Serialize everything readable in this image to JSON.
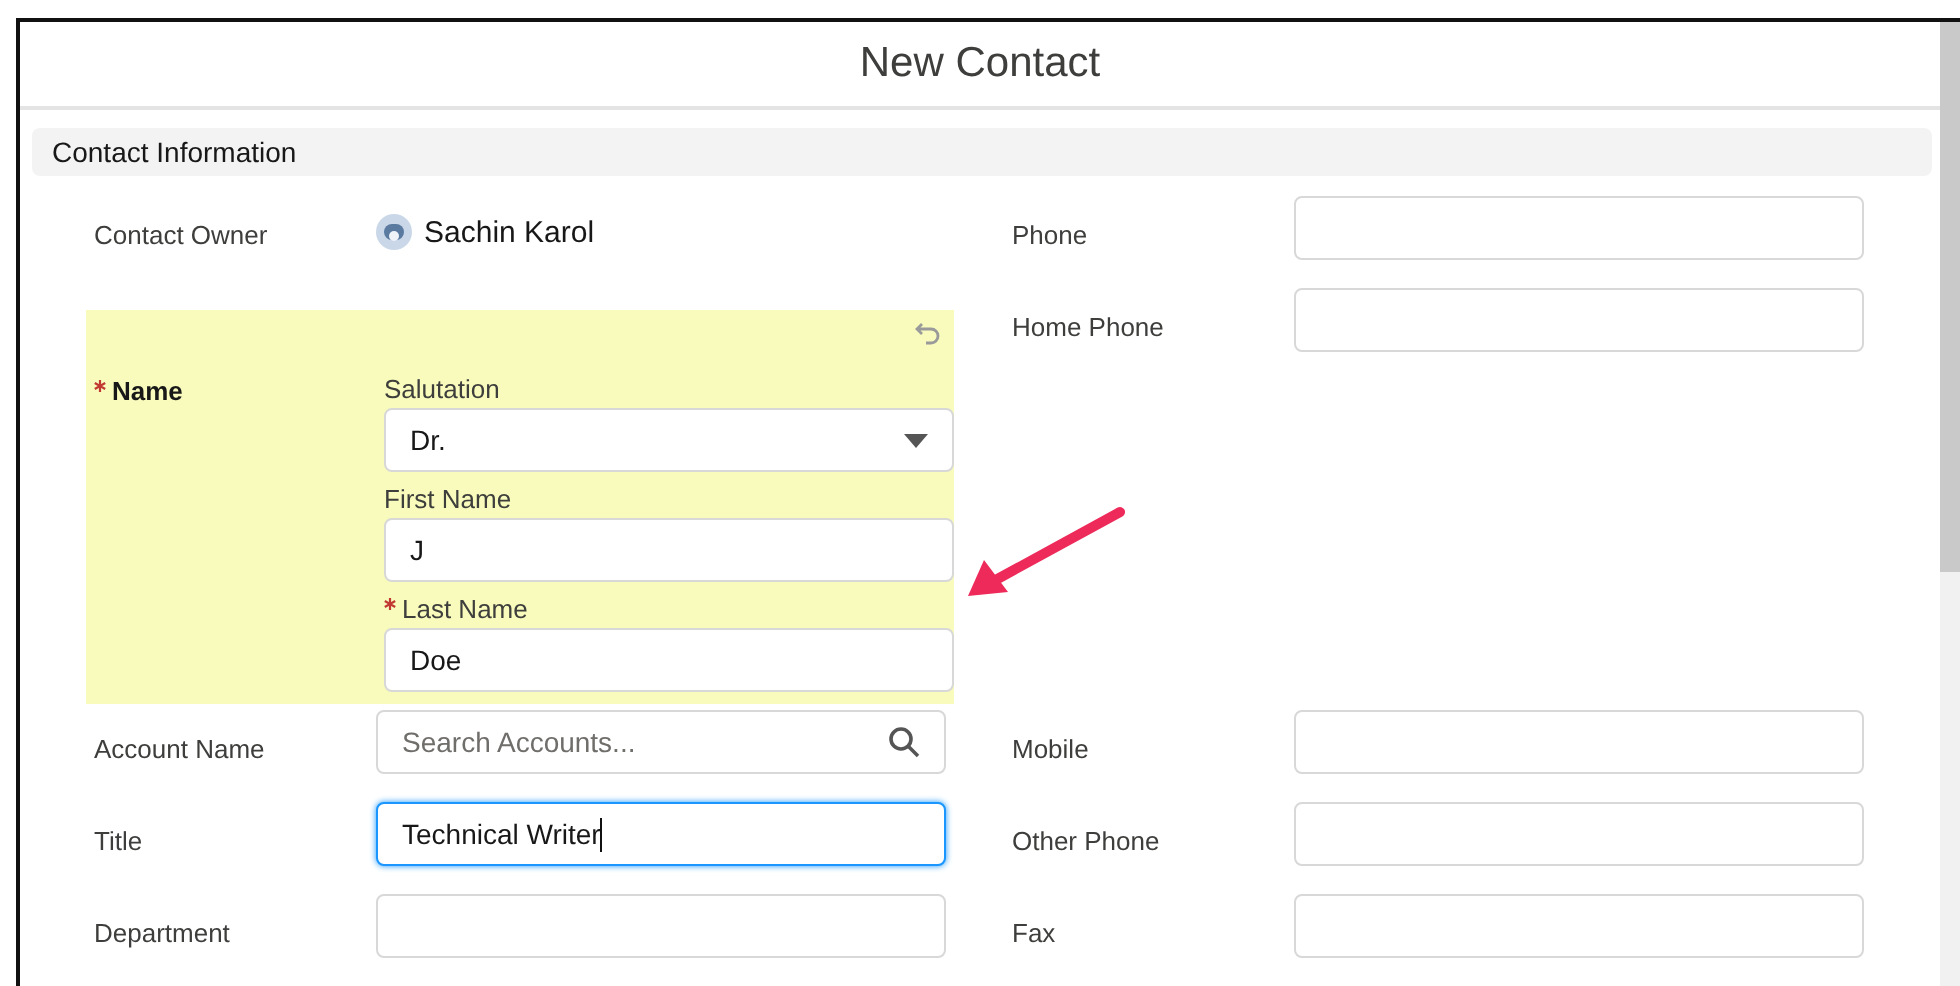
{
  "modal": {
    "title": "New Contact"
  },
  "section": {
    "title": "Contact Information"
  },
  "rows": [
    {
      "left": [
        {
          "kind": "owner",
          "label": "Contact Owner",
          "value": "Sachin Karol"
        },
        {
          "kind": "name",
          "label": "Name",
          "required": true,
          "edited": true,
          "parts": [
            {
              "kind": "select",
              "label": "Salutation",
              "value": "Dr.",
              "required": false
            },
            {
              "kind": "text",
              "label": "First Name",
              "value": "J",
              "required": false
            },
            {
              "kind": "text",
              "label": "Last Name",
              "value": "Doe",
              "required": true
            }
          ]
        }
      ],
      "right": [
        {
          "kind": "text",
          "label": "Phone",
          "focused": false
        },
        {
          "kind": "text",
          "label": "Home Phone",
          "focused": false
        }
      ]
    },
    {
      "left": [
        {
          "kind": "lookup",
          "label": "Account Name",
          "placeholder": "Search Accounts..."
        }
      ],
      "right": [
        {
          "kind": "text",
          "label": "Mobile",
          "focused": false
        }
      ]
    },
    {
      "left": [
        {
          "kind": "text",
          "label": "Title",
          "value": "Technical Writer",
          "focused": true
        }
      ],
      "right": [
        {
          "kind": "text",
          "label": "Other Phone",
          "focused": false
        }
      ]
    },
    {
      "left": [
        {
          "kind": "text",
          "label": "Department",
          "focused": false
        }
      ],
      "right": [
        {
          "kind": "text",
          "label": "Fax",
          "focused": false
        }
      ]
    }
  ]
}
